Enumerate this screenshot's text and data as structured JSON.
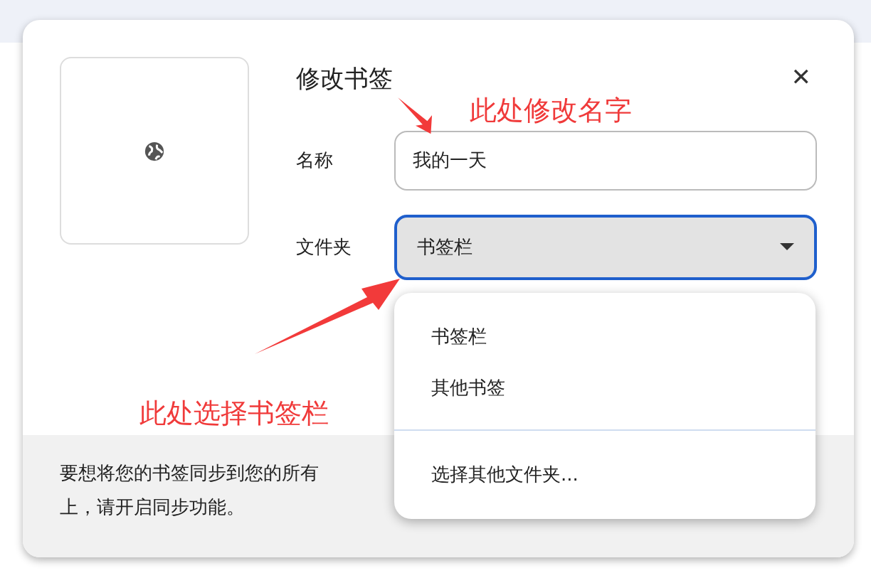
{
  "dialog": {
    "title": "修改书签",
    "close": "✕",
    "fields": [
      {
        "kind": "text",
        "label": "名称",
        "value": "我的一天"
      },
      {
        "kind": "select",
        "label": "文件夹",
        "value": "书签栏",
        "expanded": true
      }
    ],
    "footer_lines": [
      "要想将您的书签同步到您的所有",
      "上，请开启同步功能。"
    ]
  },
  "dropdown": {
    "groups": [
      [
        "书签栏",
        "其他书签"
      ],
      [
        "选择其他文件夹..."
      ]
    ]
  },
  "annotations": [
    {
      "text": "此处修改名字"
    },
    {
      "text": "此处选择书签栏"
    }
  ]
}
